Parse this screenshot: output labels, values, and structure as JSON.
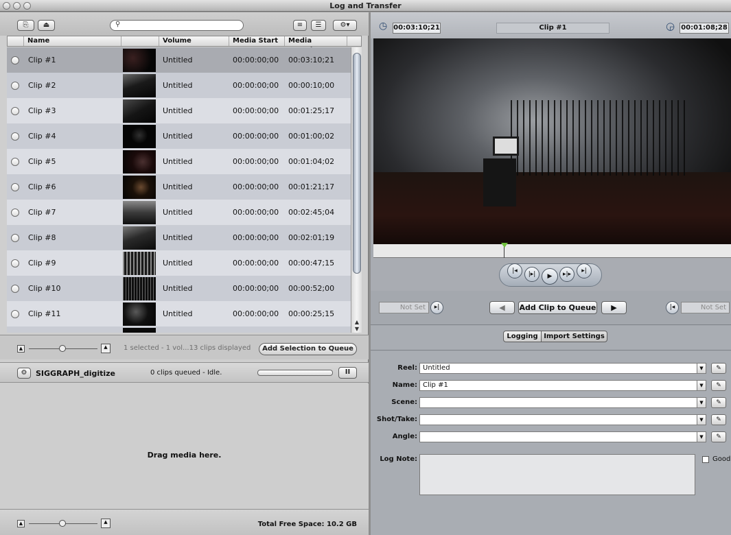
{
  "window": {
    "title": "Log and Transfer"
  },
  "left_toolbar": {
    "search_placeholder": ""
  },
  "table": {
    "columns": [
      "Name",
      "",
      "Volume",
      "Media Start",
      "Media Duration"
    ],
    "rows": [
      {
        "name": "Clip #1",
        "volume": "Untitled",
        "start": "00:00:00;00",
        "duration": "00:03:10;21"
      },
      {
        "name": "Clip #2",
        "volume": "Untitled",
        "start": "00:00:00;00",
        "duration": "00:00:10;00"
      },
      {
        "name": "Clip #3",
        "volume": "Untitled",
        "start": "00:00:00;00",
        "duration": "00:01:25;17"
      },
      {
        "name": "Clip #4",
        "volume": "Untitled",
        "start": "00:00:00;00",
        "duration": "00:01:00;02"
      },
      {
        "name": "Clip #5",
        "volume": "Untitled",
        "start": "00:00:00;00",
        "duration": "00:01:04;02"
      },
      {
        "name": "Clip #6",
        "volume": "Untitled",
        "start": "00:00:00;00",
        "duration": "00:01:21;17"
      },
      {
        "name": "Clip #7",
        "volume": "Untitled",
        "start": "00:00:00;00",
        "duration": "00:02:45;04"
      },
      {
        "name": "Clip #8",
        "volume": "Untitled",
        "start": "00:00:00;00",
        "duration": "00:02:01;19"
      },
      {
        "name": "Clip #9",
        "volume": "Untitled",
        "start": "00:00:00;00",
        "duration": "00:00:47;15"
      },
      {
        "name": "Clip #10",
        "volume": "Untitled",
        "start": "00:00:00;00",
        "duration": "00:00:52;00"
      },
      {
        "name": "Clip #11",
        "volume": "Untitled",
        "start": "00:00:00;00",
        "duration": "00:00:25;15"
      }
    ]
  },
  "browser_footer": {
    "status": "1 selected - 1 vol...13 clips displayed",
    "add_selection_label": "Add Selection to Queue"
  },
  "queue": {
    "name": "SIGGRAPH_digitize",
    "status": "0 clips queued - Idle.",
    "pause_label": "II",
    "drop_hint": "Drag media here.",
    "free_space": "Total Free Space: 10.2 GB"
  },
  "viewer": {
    "duration_tc": "00:03:10;21",
    "clip_name": "Clip #1",
    "current_tc": "00:01:08;28"
  },
  "marks": {
    "in_label": "Not Set",
    "out_label": "Not Set",
    "add_clip_label": "Add Clip to Queue"
  },
  "tabs": {
    "logging": "Logging",
    "import_settings": "Import Settings"
  },
  "logging": {
    "reel_label": "Reel:",
    "reel_value": "Untitled",
    "name_label": "Name:",
    "name_value": "Clip #1",
    "scene_label": "Scene:",
    "scene_value": "",
    "shot_label": "Shot/Take:",
    "shot_value": "",
    "angle_label": "Angle:",
    "angle_value": "",
    "lognote_label": "Log Note:",
    "good_label": "Good"
  },
  "colors": {
    "selection": "#a9abb1",
    "playhead": "#6fbf3d"
  }
}
